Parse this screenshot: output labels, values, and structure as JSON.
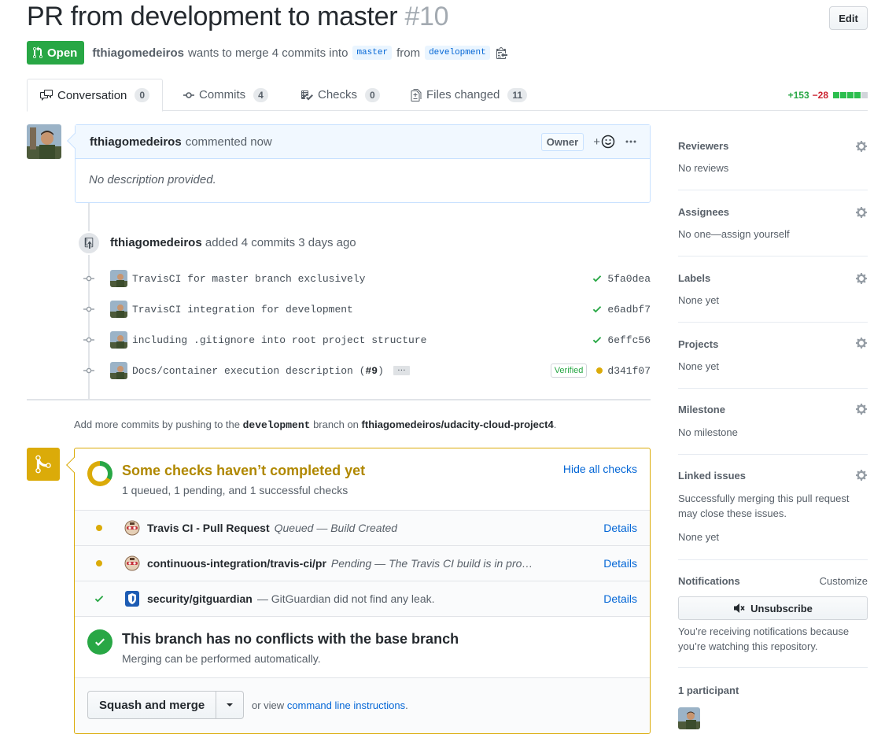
{
  "header": {
    "title": "PR from development to master",
    "number": "#10",
    "edit_label": "Edit",
    "state": "Open",
    "author": "fthiagomedeiros",
    "merge_text": "wants to merge 4 commits into",
    "base_branch": "master",
    "from_text": "from",
    "head_branch": "development"
  },
  "tabs": [
    {
      "label": "Conversation",
      "count": "0"
    },
    {
      "label": "Commits",
      "count": "4"
    },
    {
      "label": "Checks",
      "count": "0"
    },
    {
      "label": "Files changed",
      "count": "11"
    }
  ],
  "diffstat": {
    "additions": "+153",
    "deletions": "−28"
  },
  "comment": {
    "author": "fthiagomedeiros",
    "time": "commented now",
    "role": "Owner",
    "reaction_plus": "+",
    "body": "No description provided."
  },
  "push_event": {
    "author": "fthiagomedeiros",
    "text": "added 4 commits 3 days ago"
  },
  "commits": [
    {
      "message": "TravisCI for master branch exclusively",
      "sha": "5fa0dea",
      "status": "success"
    },
    {
      "message": "TravisCI integration for development",
      "sha": "e6adbf7",
      "status": "success"
    },
    {
      "message": "including .gitignore into root project structure",
      "sha": "6effc56",
      "status": "success"
    },
    {
      "message": "Docs/container execution description (",
      "pr_ref": "#9",
      "message_end": ")",
      "sha": "d341f07",
      "status": "pending",
      "verified": "Verified",
      "ellipsis": "…"
    }
  ],
  "push_hint": {
    "prefix": "Add more commits by pushing to the",
    "branch": "development",
    "middle": "branch on",
    "repo": "fthiagomedeiros/udacity-cloud-project4",
    "suffix": "."
  },
  "checks": {
    "title": "Some checks haven’t completed yet",
    "subtitle": "1 queued, 1 pending, and 1 successful checks",
    "hide_label": "Hide all checks",
    "items": [
      {
        "name": "Travis CI - Pull Request",
        "desc": "Queued — Build Created",
        "details": "Details",
        "status": "queued"
      },
      {
        "name": "continuous-integration/travis-ci/pr",
        "desc": "Pending — The Travis CI build is in progress",
        "details": "Details",
        "status": "pending"
      },
      {
        "name": "security/gitguardian",
        "desc": "— GitGuardian did not find any leak.",
        "details": "Details",
        "status": "success"
      }
    ]
  },
  "conflicts": {
    "title": "This branch has no conflicts with the base branch",
    "subtitle": "Merging can be performed automatically."
  },
  "merge": {
    "button_label": "Squash and merge",
    "or_view": "or view",
    "cli_link": "command line instructions",
    "period": "."
  },
  "sidebar": {
    "reviewers": {
      "title": "Reviewers",
      "value": "No reviews"
    },
    "assignees": {
      "title": "Assignees",
      "value": "No one—assign yourself"
    },
    "labels": {
      "title": "Labels",
      "value": "None yet"
    },
    "projects": {
      "title": "Projects",
      "value": "None yet"
    },
    "milestone": {
      "title": "Milestone",
      "value": "No milestone"
    },
    "linked_issues": {
      "title": "Linked issues",
      "desc": "Successfully merging this pull request may close these issues.",
      "value": "None yet"
    },
    "notifications": {
      "title": "Notifications",
      "customize": "Customize",
      "unsubscribe": "Unsubscribe",
      "reason": "You’re receiving notifications because you’re watching this repository."
    },
    "participants": {
      "title": "1 participant"
    }
  },
  "colors": {
    "open": "#28a745",
    "pending": "#dbab09",
    "link": "#0366d6",
    "deletion": "#cb2431"
  }
}
